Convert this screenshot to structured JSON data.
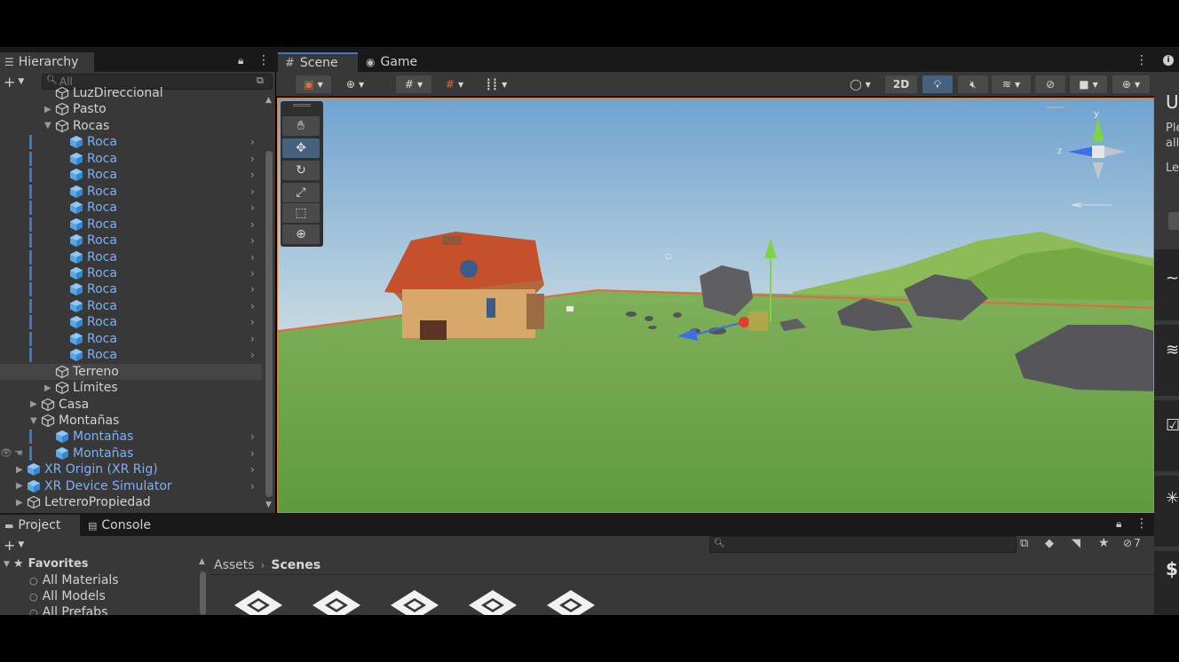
{
  "hierarchy": {
    "tab_label": "Hierarchy",
    "search_placeholder": "All",
    "rows": [
      {
        "label": "LuzDireccional",
        "indent": 4,
        "expand": "",
        "prefab": false
      },
      {
        "label": "Pasto",
        "indent": 4,
        "expand": "right",
        "prefab": false
      },
      {
        "label": "Rocas",
        "indent": 4,
        "expand": "down",
        "prefab": false
      },
      {
        "label": "Roca",
        "indent": 5,
        "expand": "",
        "prefab": true
      },
      {
        "label": "Roca",
        "indent": 5,
        "expand": "",
        "prefab": true
      },
      {
        "label": "Roca",
        "indent": 5,
        "expand": "",
        "prefab": true
      },
      {
        "label": "Roca",
        "indent": 5,
        "expand": "",
        "prefab": true
      },
      {
        "label": "Roca",
        "indent": 5,
        "expand": "",
        "prefab": true
      },
      {
        "label": "Roca",
        "indent": 5,
        "expand": "",
        "prefab": true
      },
      {
        "label": "Roca",
        "indent": 5,
        "expand": "",
        "prefab": true
      },
      {
        "label": "Roca",
        "indent": 5,
        "expand": "",
        "prefab": true
      },
      {
        "label": "Roca",
        "indent": 5,
        "expand": "",
        "prefab": true
      },
      {
        "label": "Roca",
        "indent": 5,
        "expand": "",
        "prefab": true
      },
      {
        "label": "Roca",
        "indent": 5,
        "expand": "",
        "prefab": true
      },
      {
        "label": "Roca",
        "indent": 5,
        "expand": "",
        "prefab": true
      },
      {
        "label": "Roca",
        "indent": 5,
        "expand": "",
        "prefab": true
      },
      {
        "label": "Roca",
        "indent": 5,
        "expand": "",
        "prefab": true
      },
      {
        "label": "Terreno",
        "indent": 4,
        "expand": "",
        "prefab": false,
        "hovered": true
      },
      {
        "label": "Límites",
        "indent": 4,
        "expand": "right",
        "prefab": false
      },
      {
        "label": "Casa",
        "indent": 3,
        "expand": "right",
        "prefab": false
      },
      {
        "label": "Montañas",
        "indent": 3,
        "expand": "down",
        "prefab": false
      },
      {
        "label": "Montañas",
        "indent": 4,
        "expand": "",
        "prefab": true
      },
      {
        "label": "Montañas",
        "indent": 4,
        "expand": "",
        "prefab": true,
        "eye": true
      },
      {
        "label": "XR Origin (XR Rig)",
        "indent": 2,
        "expand": "right",
        "prefab": true
      },
      {
        "label": "XR Device Simulator",
        "indent": 2,
        "expand": "right",
        "prefab": true
      },
      {
        "label": "LetreroPropiedad",
        "indent": 2,
        "expand": "right",
        "prefab": false
      }
    ]
  },
  "scene": {
    "tab_scene": "Scene",
    "tab_game": "Game",
    "btn_2d": "2D",
    "gizmo_y": "y",
    "gizmo_z": "z"
  },
  "project": {
    "tab_project": "Project",
    "tab_console": "Console",
    "hidden_count": "7",
    "favorites_label": "Favorites",
    "favorites": [
      "All Materials",
      "All Models",
      "All Prefabs"
    ],
    "breadcrumb_root": "Assets",
    "breadcrumb_current": "Scenes",
    "scene_assets_count": 5
  },
  "inspector_partial": {
    "title_fragment": "U",
    "line1": "Ple",
    "line2": "all",
    "line3": "Le"
  },
  "colors": {
    "panel_bg": "#383838",
    "header_bg": "#282828",
    "prefab_blue": "#7cb1f5",
    "selection": "#3a79c9",
    "sky_top": "#71a8d4",
    "ground": "#6aa146"
  }
}
